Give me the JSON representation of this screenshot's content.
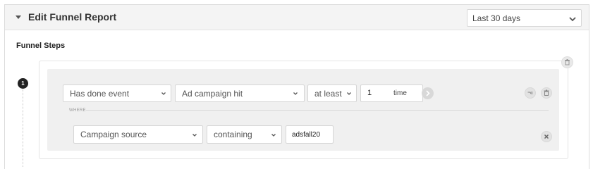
{
  "header": {
    "title": "Edit Funnel Report",
    "date_range": "Last 30 days"
  },
  "funnel": {
    "section_label": "Funnel Steps",
    "steps": [
      {
        "number": "1",
        "event_mode": "Has done event",
        "event_name": "Ad campaign hit",
        "frequency": "at least",
        "count": "1",
        "count_unit": "time",
        "where_label": "WHERE",
        "filter": {
          "property": "Campaign source",
          "operator": "containing",
          "value": "adsfall20"
        }
      }
    ]
  },
  "icons": {
    "collapse": "caret-down-icon",
    "dropdown": "chevron-down-icon",
    "advance": "chevron-right-icon",
    "options": "filter-options-icon",
    "delete": "trash-icon",
    "remove": "close-icon"
  }
}
